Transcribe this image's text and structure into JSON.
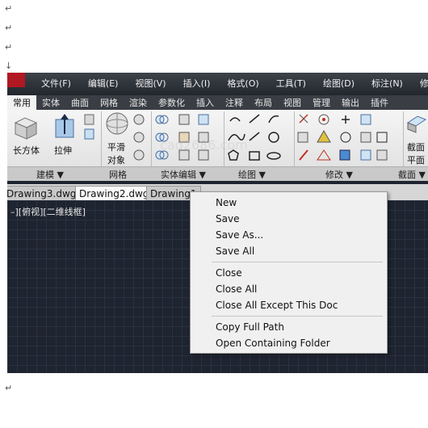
{
  "doc_marks": [
    "↵",
    "↵",
    "↓",
    "↵"
  ],
  "menubar": {
    "items": [
      "文件(F)",
      "编辑(E)",
      "视图(V)",
      "插入(I)",
      "格式(O)",
      "工具(T)",
      "绘图(D)",
      "标注(N)",
      "修改"
    ]
  },
  "ribbon_tabs": [
    "常用",
    "实体",
    "曲面",
    "网格",
    "渲染",
    "参数化",
    "插入",
    "注释",
    "布局",
    "视图",
    "管理",
    "输出",
    "插件"
  ],
  "ribbon": {
    "box_label": "长方体",
    "extrude_label": "拉伸",
    "smooth_label_1": "平滑",
    "smooth_label_2": "对象",
    "section_label_1": "截面",
    "section_label_2": "平面",
    "panels": [
      "建模 ▼",
      "网格",
      "实体编辑 ▼",
      "绘图 ▼",
      "修改 ▼",
      "截面 ▼"
    ]
  },
  "doc_tabs": [
    "Drawing3.dwg *",
    "Drawing2.dwg",
    "Drawing1"
  ],
  "viewport_label": "–][俯视][二维线框]",
  "watermark": "cad2686.com",
  "context_menu": {
    "items": [
      "New",
      "Save",
      "Save As...",
      "Save All",
      "Close",
      "Close All",
      "Close All Except This Doc",
      "Copy Full Path",
      "Open Containing Folder"
    ]
  }
}
